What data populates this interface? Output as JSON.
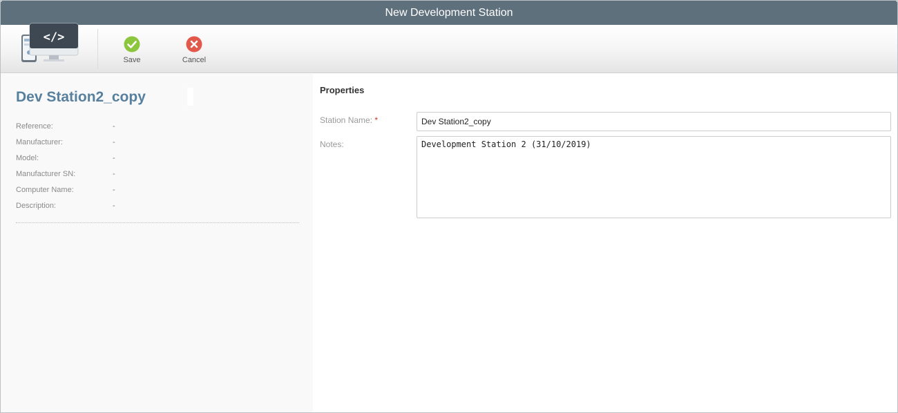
{
  "window": {
    "title": "New Development Station"
  },
  "toolbar": {
    "app_icon": "dev-station-monitor-code-icon",
    "save_label": "Save",
    "cancel_label": "Cancel",
    "save_icon": "check-circle-icon",
    "cancel_icon": "x-circle-icon"
  },
  "left_panel": {
    "station_name": "Dev Station2_copy",
    "info": [
      {
        "label": "Reference:",
        "value": "-"
      },
      {
        "label": "Manufacturer:",
        "value": "-"
      },
      {
        "label": "Model:",
        "value": "-"
      },
      {
        "label": "Manufacturer SN:",
        "value": "-"
      },
      {
        "label": "Computer Name:",
        "value": "-"
      },
      {
        "label": "Description:",
        "value": "-"
      }
    ]
  },
  "properties": {
    "section_title": "Properties",
    "station_name_label": "Station Name:",
    "required_mark": "*",
    "station_name_value": "Dev Station2_copy",
    "notes_label": "Notes:",
    "notes_value": "Development Station 2 (31/10/2019)"
  },
  "colors": {
    "titlebar": "#5f707d",
    "accent_title": "#57809e",
    "save_green": "#8cc63e",
    "cancel_red": "#e0594a"
  }
}
